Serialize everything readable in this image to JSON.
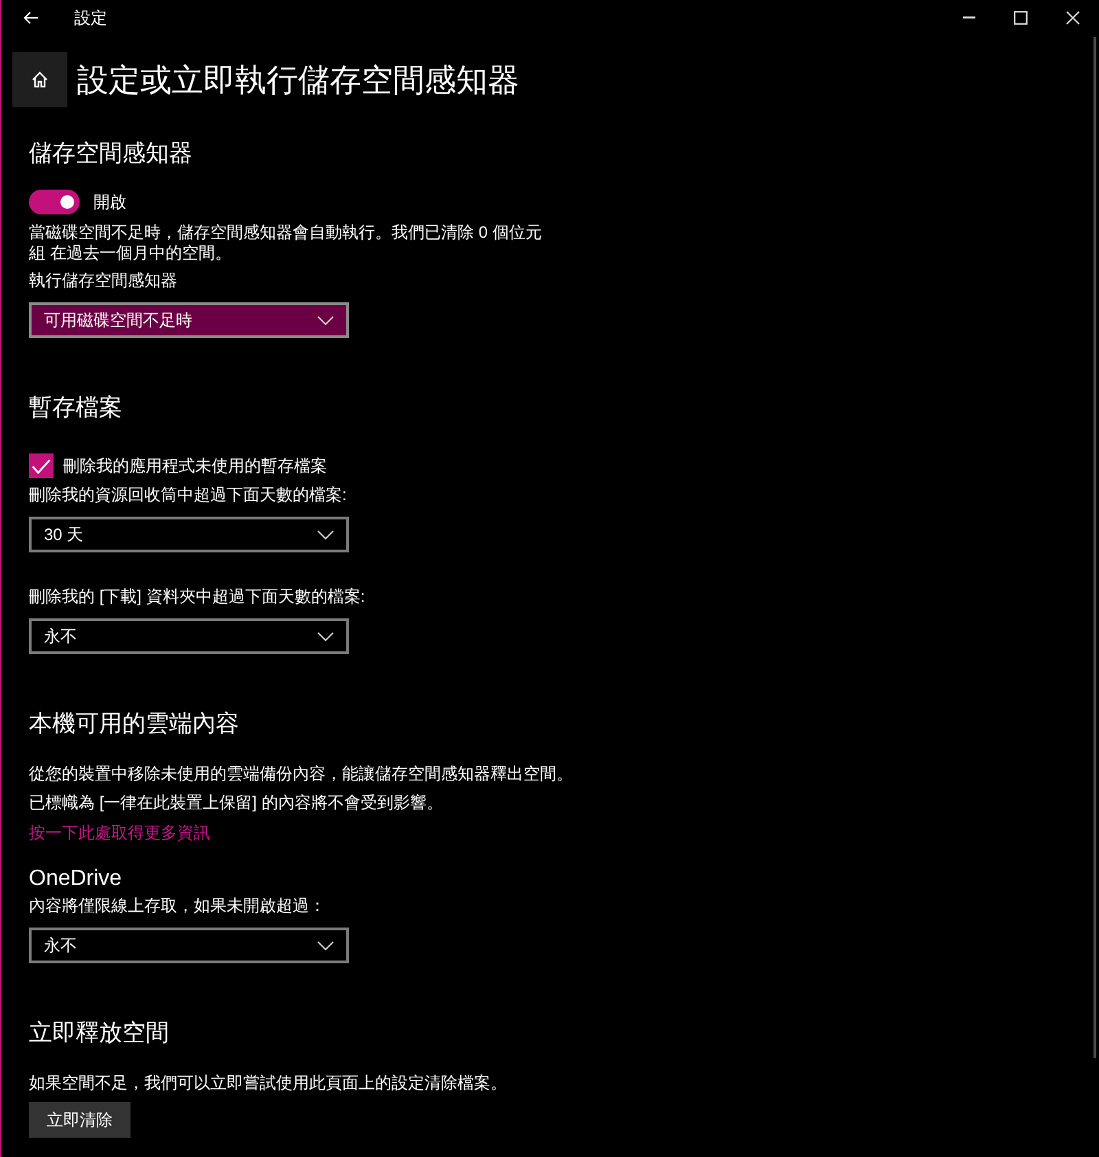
{
  "window": {
    "title": "設定"
  },
  "page": {
    "title": "設定或立即執行儲存空間感知器"
  },
  "sections": [
    {
      "heading": "儲存空間感知器",
      "items": [
        {
          "kind": "toggle",
          "label": "開啟",
          "on": true
        },
        {
          "kind": "summary",
          "text": "當磁碟空間不足時，儲存空間感知器會自動執行。我們已清除 0 個位元組 在過去一個月中的空間。"
        },
        {
          "kind": "label",
          "text": "執行儲存空間感知器"
        },
        {
          "kind": "dropdown",
          "value": "可用磁碟空間不足時",
          "highlighted": true
        }
      ]
    },
    {
      "heading": "暫存檔案",
      "items": [
        {
          "kind": "checkbox",
          "label": "刪除我的應用程式未使用的暫存檔案",
          "checked": true
        },
        {
          "kind": "label",
          "text": "刪除我的資源回收筒中超過下面天數的檔案:"
        },
        {
          "kind": "dropdown",
          "value": "30 天",
          "highlighted": false
        },
        {
          "kind": "label",
          "text": "刪除我的 [下載] 資料夾中超過下面天數的檔案:"
        },
        {
          "kind": "dropdown",
          "value": "永不",
          "highlighted": false
        }
      ]
    },
    {
      "heading": "本機可用的雲端內容",
      "items": [
        {
          "kind": "text",
          "text": "從您的裝置中移除未使用的雲端備份內容，能讓儲存空間感知器釋出空間。"
        },
        {
          "kind": "text",
          "text": "已標幟為 [一律在此裝置上保留] 的內容將不會受到影響。"
        },
        {
          "kind": "link",
          "text": "按一下此處取得更多資訊"
        },
        {
          "kind": "subheading",
          "text": "OneDrive"
        },
        {
          "kind": "label",
          "text": "內容將僅限線上存取，如果未開啟超過："
        },
        {
          "kind": "dropdown",
          "value": "永不",
          "highlighted": false
        }
      ]
    },
    {
      "heading": "立即釋放空間",
      "items": [
        {
          "kind": "text",
          "text": "如果空間不足，我們可以立即嘗試使用此頁面上的設定清除檔案。"
        },
        {
          "kind": "button",
          "label": "立即清除"
        }
      ]
    }
  ]
}
